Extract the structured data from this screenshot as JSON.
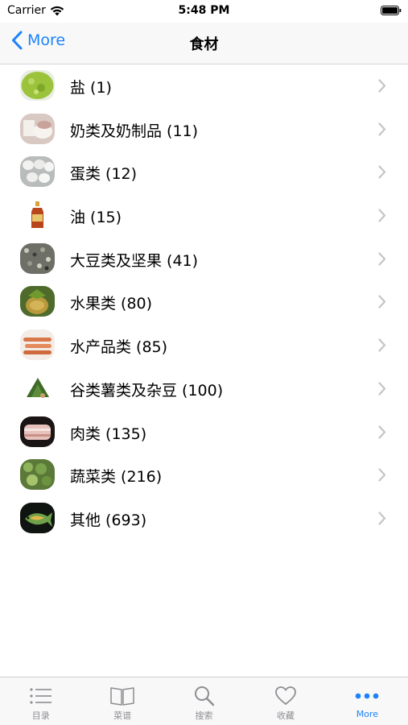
{
  "status_bar": {
    "carrier": "Carrier",
    "time": "5:48 PM"
  },
  "nav": {
    "back_label": "More",
    "title": "食材"
  },
  "list": {
    "items": [
      {
        "label": "盐 (1)",
        "icon": "salt-thumbnail"
      },
      {
        "label": "奶类及奶制品 (11)",
        "icon": "dairy-thumbnail"
      },
      {
        "label": "蛋类 (12)",
        "icon": "eggs-thumbnail"
      },
      {
        "label": "油 (15)",
        "icon": "oil-bottle-thumbnail"
      },
      {
        "label": "大豆类及坚果 (41)",
        "icon": "beans-nuts-thumbnail"
      },
      {
        "label": "水果类 (80)",
        "icon": "fruit-thumbnail"
      },
      {
        "label": "水产品类 (85)",
        "icon": "seafood-thumbnail"
      },
      {
        "label": "谷类薯类及杂豆 (100)",
        "icon": "grains-thumbnail"
      },
      {
        "label": "肉类 (135)",
        "icon": "meat-thumbnail"
      },
      {
        "label": "蔬菜类 (216)",
        "icon": "vegetables-thumbnail"
      },
      {
        "label": "其他 (693)",
        "icon": "other-thumbnail"
      }
    ]
  },
  "tab_bar": {
    "tabs": [
      {
        "label": "目录",
        "icon": "list-icon",
        "active": false
      },
      {
        "label": "菜谱",
        "icon": "book-icon",
        "active": false
      },
      {
        "label": "搜索",
        "icon": "search-icon",
        "active": false
      },
      {
        "label": "收藏",
        "icon": "heart-icon",
        "active": false
      },
      {
        "label": "More",
        "icon": "more-dots-icon",
        "active": true
      }
    ]
  },
  "colors": {
    "accent": "#1a82fb",
    "inactive_tab": "#8e8e93",
    "bar_background": "#f8f8f8",
    "chevron": "#c4c4c7"
  }
}
